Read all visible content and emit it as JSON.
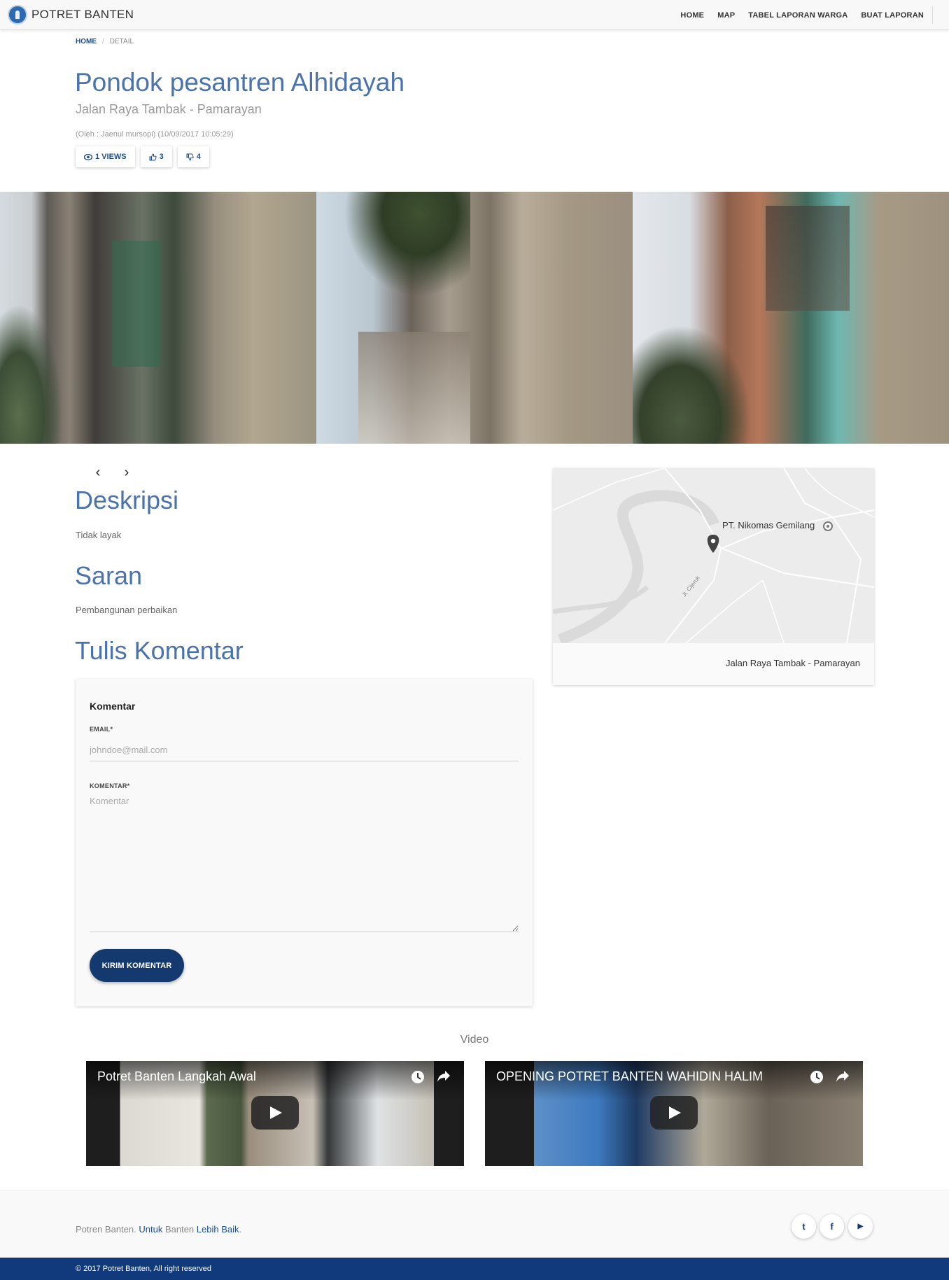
{
  "navbar": {
    "brand": "POTRET BANTEN",
    "links": [
      "HOME",
      "MAP",
      "TABEL LAPORAN WARGA",
      "BUAT LAPORAN"
    ]
  },
  "breadcrumb": {
    "home": "HOME",
    "separator": "/",
    "current": "DETAIL"
  },
  "report": {
    "title": "Pondok pesantren Alhidayah",
    "location": "Jalan Raya Tambak - Pamarayan",
    "meta": "(Oleh : Jaenul mursopi) (10/09/2017 10:05:29)",
    "views_label": "1 VIEWS",
    "likes": "3",
    "dislikes": "4",
    "icons": {
      "views": "eye-icon",
      "likes": "thumbs-up-icon",
      "dislikes": "thumbs-down-icon"
    }
  },
  "carousel": {
    "prev_icon": "chevron-left-icon",
    "next_icon": "chevron-right-icon",
    "prev_glyph": "‹",
    "next_glyph": "›"
  },
  "deskripsi": {
    "heading": "Deskripsi",
    "text": "Tidak layak"
  },
  "saran": {
    "heading": "Saran",
    "text": "Pembangunan perbaikan"
  },
  "comment": {
    "heading": "Tulis Komentar",
    "card_title": "Komentar",
    "email_label": "EMAIL*",
    "email_placeholder": "johndoe@mail.com",
    "comment_label": "KOMENTAR*",
    "comment_placeholder": "Komentar",
    "submit_label": "KIRIM KOMENTAR"
  },
  "map": {
    "place_label": "PT. Nikomas Gemilang",
    "road_label": "Jl. Cijeruk",
    "caption": "Jalan Raya Tambak - Pamarayan"
  },
  "videos": {
    "heading": "Video",
    "items": [
      {
        "title": "Potret Banten Langkah Awal"
      },
      {
        "title": "OPENING POTRET BANTEN WAHIDIN HALIM"
      }
    ]
  },
  "footer": {
    "tagline_1": "Potren Banten.",
    "tagline_2": "Untuk",
    "tagline_3": "Banten",
    "tagline_4": "Lebih Baik",
    "tagline_5": ".",
    "social": [
      {
        "name": "twitter-icon",
        "glyph": "t"
      },
      {
        "name": "facebook-icon",
        "glyph": "f"
      },
      {
        "name": "youtube-icon",
        "glyph": "▶"
      }
    ],
    "copyright": "© 2017 Potret Banten, All right reserved"
  },
  "colors": {
    "primary": "#14396f",
    "heading": "#4a73ab",
    "footer_bar": "#113a7c"
  }
}
